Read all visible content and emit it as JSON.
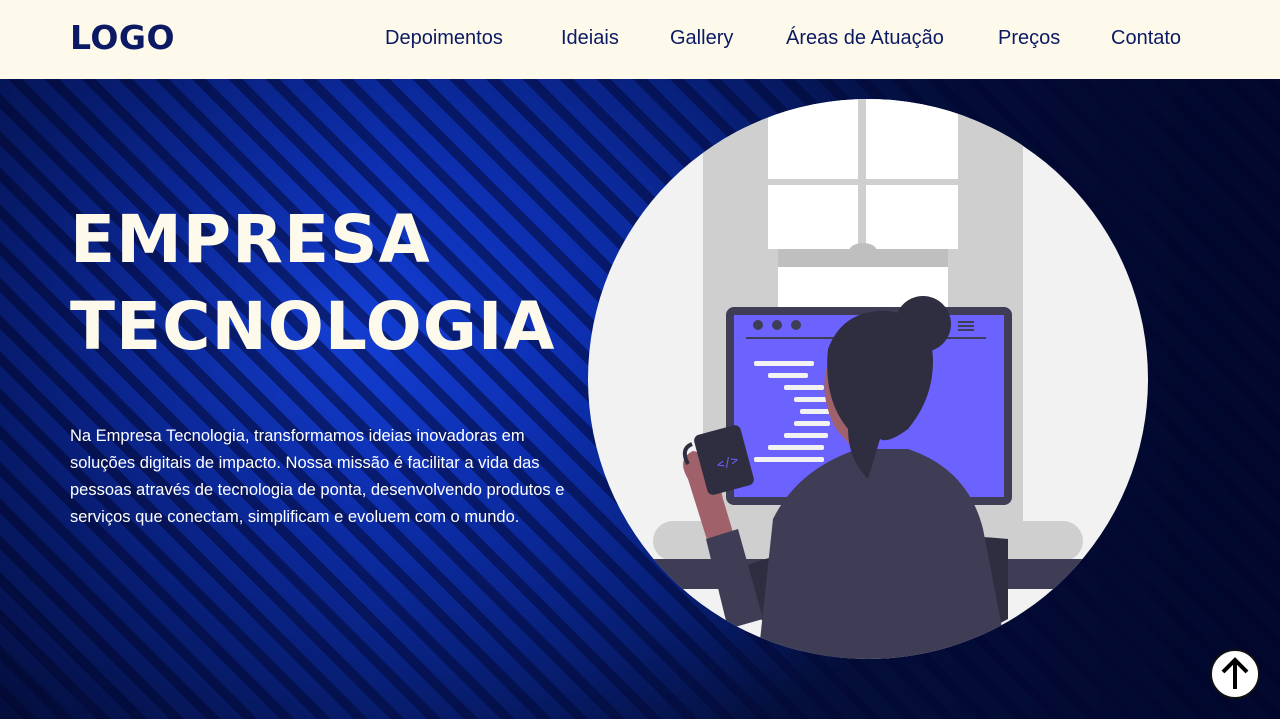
{
  "header": {
    "logo": "LOGO",
    "nav": [
      {
        "label": "Depoimentos"
      },
      {
        "label": "Ideiais"
      },
      {
        "label": "Gallery"
      },
      {
        "label": "Áreas de Atuação"
      },
      {
        "label": "Preços"
      },
      {
        "label": "Contato"
      }
    ]
  },
  "hero": {
    "title_line1": "EMPRESA",
    "title_line2": "TECNOLOGIA",
    "description": "Na Empresa Tecnologia, transformamos ideias inovadoras em soluções digitais de impacto. Nossa missão é facilitar a vida das pessoas através de tecnologia de ponta, desenvolvendo produtos e serviços que conectam, simplificam e evoluem com o mundo.",
    "illustration_code_glyph": "</>"
  },
  "colors": {
    "header_bg": "#fdfaeb",
    "nav_text": "#0c1a63",
    "hero_blue": "#0d2fb0",
    "screen_purple": "#6c63ff"
  },
  "icons": {
    "scroll_top": "arrow-up-icon"
  }
}
